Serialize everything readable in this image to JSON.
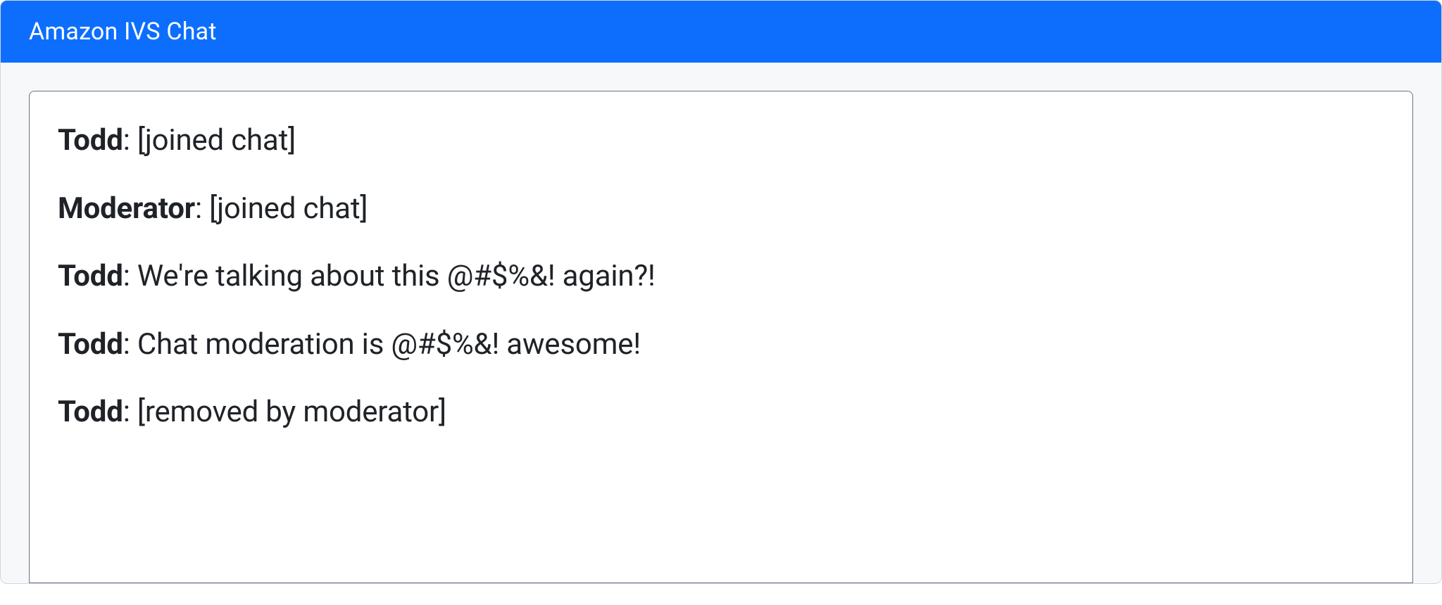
{
  "header": {
    "title": "Amazon IVS Chat"
  },
  "chat": {
    "separator": ": ",
    "messages": [
      {
        "user": "Todd",
        "text": "[joined chat]"
      },
      {
        "user": "Moderator",
        "text": "[joined chat]"
      },
      {
        "user": "Todd",
        "text": "We're talking about this @#$%&! again?!"
      },
      {
        "user": "Todd",
        "text": "Chat moderation is @#$%&! awesome!"
      },
      {
        "user": "Todd",
        "text": "[removed by moderator]"
      }
    ]
  }
}
